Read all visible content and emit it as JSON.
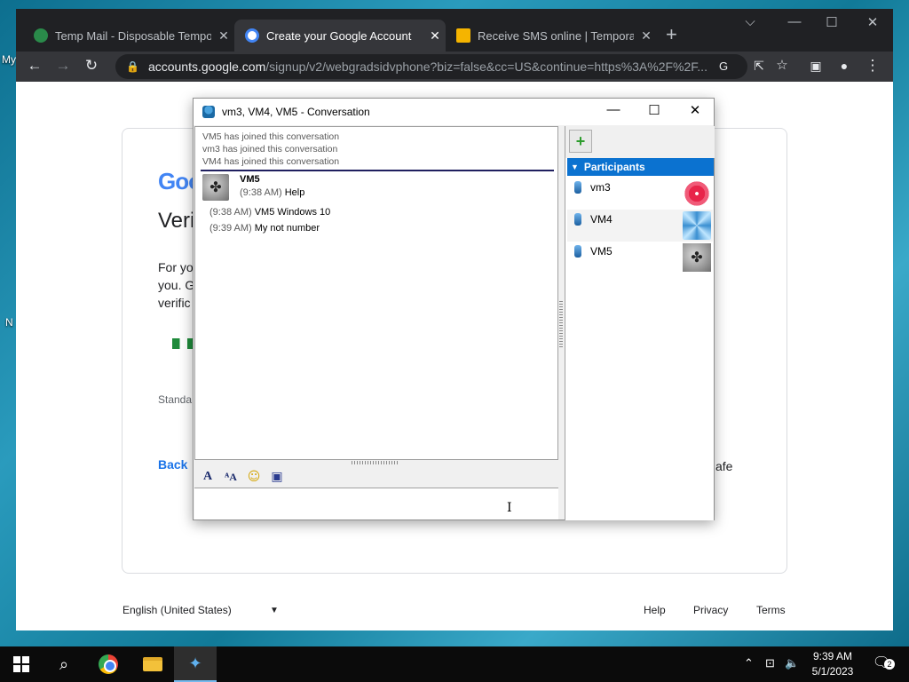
{
  "desktop": {
    "labels": [
      "My",
      "N"
    ]
  },
  "browser": {
    "tabs": [
      {
        "title": "Temp Mail - Disposable Temporary",
        "close": "✕",
        "favicon_color": "#34a853"
      },
      {
        "title": "Create your Google Account",
        "close": "✕",
        "favicon_color": "#4285f4"
      },
      {
        "title": "Receive SMS online | Temporary",
        "close": "✕",
        "favicon_color": "#f5b400"
      }
    ],
    "new_tab": "+",
    "url_host": "accounts.google.com",
    "url_path": "/signup/v2/webgradsidvphone?biz=false&cc=US&continue=https%3A%2F%2F..."
  },
  "google_page": {
    "logo": "Goo",
    "heading": "Veri",
    "paragraph": "For yo you. G verific",
    "standard": "Standa",
    "back": "Back",
    "safe": "afe",
    "footer": {
      "language": "English (United States)",
      "help": "Help",
      "privacy": "Privacy",
      "terms": "Terms"
    }
  },
  "conversation": {
    "title": "vm3, VM4, VM5 - Conversation",
    "system_messages": [
      "VM5 has joined this conversation",
      "vm3 has joined this conversation",
      "VM4 has joined this conversation"
    ],
    "sender": "VM5",
    "messages": [
      {
        "time": "(9:38 AM)",
        "text": "Help"
      },
      {
        "time": "(9:38 AM)",
        "text": "VM5 Windows 10"
      },
      {
        "time": "(9:39 AM)",
        "text": "My not number"
      }
    ],
    "participants_header": "Participants",
    "participants": [
      "vm3",
      "VM4",
      "VM5"
    ]
  },
  "taskbar": {
    "time": "9:39 AM",
    "date": "5/1/2023",
    "notification_count": "2"
  }
}
